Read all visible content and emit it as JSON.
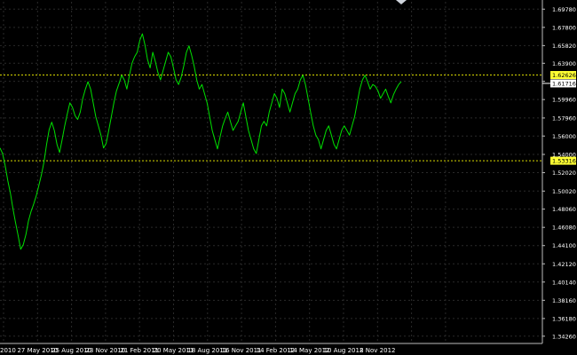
{
  "chart_data": {
    "type": "line",
    "instrument_note": "",
    "x_tick_labels": [
      "2010",
      "27 May 2010",
      "25 Aug 2010",
      "23 Nov 2010",
      "21 Feb 2011",
      "20 May 2011",
      "18 Aug 2011",
      "16 Nov 2011",
      "14 Feb 2012",
      "14 May 2012",
      "10 Aug 2012",
      "8 Nov 2012"
    ],
    "y_tick_labels": [
      "1.69780",
      "1.67800",
      "1.65820",
      "1.63900",
      "1.61940",
      "1.59960",
      "1.57960",
      "1.56000",
      "1.54000",
      "1.52020",
      "1.50020",
      "1.48060",
      "1.46080",
      "1.44100",
      "1.42120",
      "1.40140",
      "1.38160",
      "1.36180",
      "1.34260"
    ],
    "ylim": [
      1.3347,
      1.7058
    ],
    "grid": true,
    "series": [
      {
        "values": [
          1.547,
          1.541,
          1.528,
          1.512,
          1.498,
          1.481,
          1.466,
          1.452,
          1.437,
          1.442,
          1.453,
          1.468,
          1.478,
          1.486,
          1.495,
          1.506,
          1.518,
          1.532,
          1.551,
          1.567,
          1.575,
          1.566,
          1.551,
          1.542,
          1.556,
          1.571,
          1.584,
          1.596,
          1.591,
          1.582,
          1.578,
          1.586,
          1.601,
          1.611,
          1.619,
          1.611,
          1.596,
          1.581,
          1.571,
          1.561,
          1.547,
          1.552,
          1.566,
          1.581,
          1.596,
          1.609,
          1.617,
          1.626,
          1.621,
          1.611,
          1.626,
          1.639,
          1.646,
          1.651,
          1.664,
          1.671,
          1.659,
          1.643,
          1.634,
          1.651,
          1.641,
          1.629,
          1.621,
          1.631,
          1.641,
          1.651,
          1.646,
          1.634,
          1.621,
          1.616,
          1.624,
          1.636,
          1.651,
          1.658,
          1.648,
          1.636,
          1.621,
          1.611,
          1.616,
          1.606,
          1.596,
          1.581,
          1.566,
          1.556,
          1.546,
          1.559,
          1.571,
          1.579,
          1.586,
          1.576,
          1.566,
          1.571,
          1.576,
          1.586,
          1.596,
          1.581,
          1.566,
          1.556,
          1.546,
          1.541,
          1.556,
          1.571,
          1.576,
          1.571,
          1.586,
          1.596,
          1.606,
          1.601,
          1.591,
          1.611,
          1.606,
          1.596,
          1.586,
          1.596,
          1.606,
          1.611,
          1.621,
          1.626,
          1.616,
          1.601,
          1.586,
          1.571,
          1.561,
          1.556,
          1.546,
          1.556,
          1.566,
          1.571,
          1.561,
          1.551,
          1.546,
          1.556,
          1.566,
          1.571,
          1.566,
          1.561,
          1.571,
          1.581,
          1.596,
          1.611,
          1.621,
          1.626,
          1.619,
          1.611,
          1.616,
          1.614,
          1.609,
          1.601,
          1.606,
          1.611,
          1.603,
          1.596,
          1.605,
          1.611,
          1.616,
          1.619
        ]
      }
    ],
    "horizontal_lines": [
      {
        "label": "1.62626",
        "value": 1.62626
      },
      {
        "label": "1.53316",
        "value": 1.53316
      }
    ],
    "marker_price": {
      "label": "1.61716",
      "value": 1.61716
    },
    "colors": {
      "background": "#000000",
      "grid": "#2a2a2a",
      "series": "#00e000",
      "level_line": "#d8d800",
      "level_label_bg": "#ffff33",
      "marker_label_bg": "#ffffff",
      "axis_text": "#ffffff",
      "axis_line": "#bdbdbd"
    }
  }
}
